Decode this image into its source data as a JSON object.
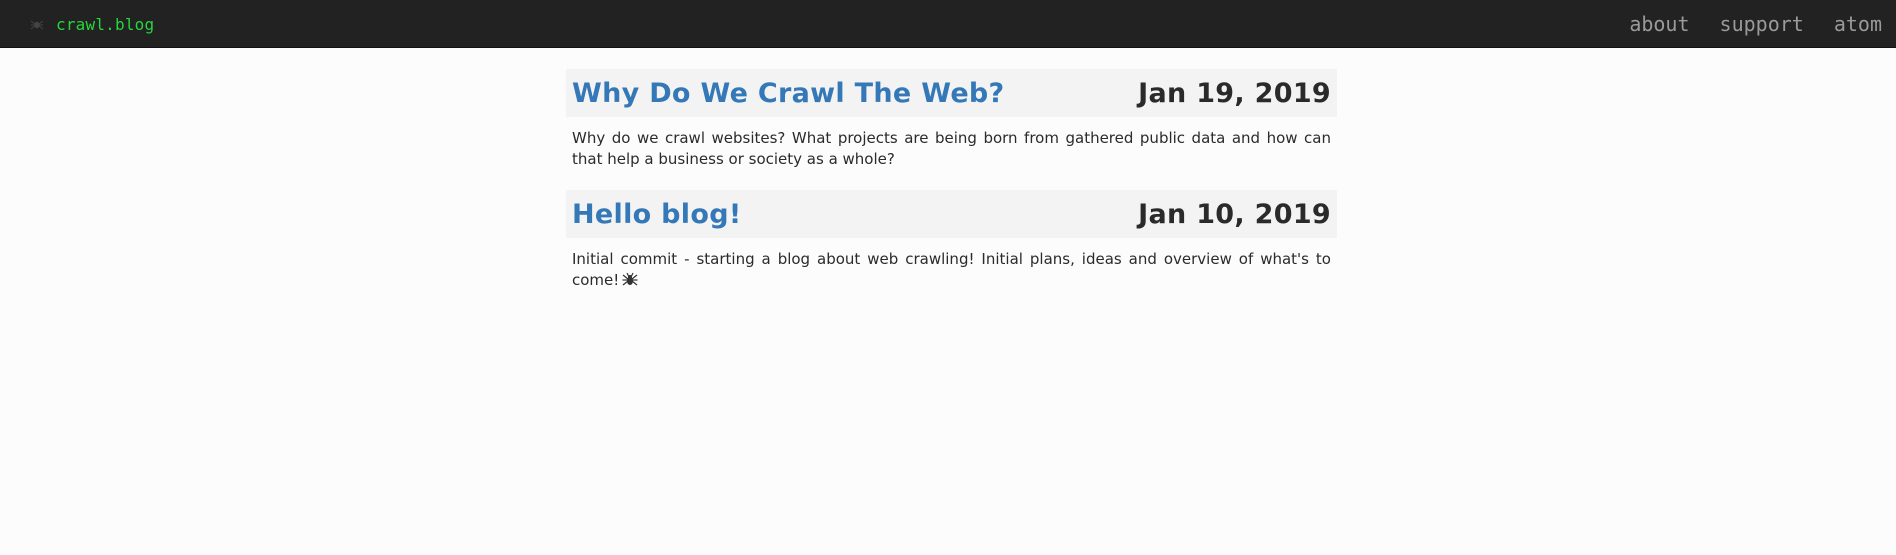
{
  "header": {
    "brand_icon": "spider-icon",
    "brand_text": "crawl.blog",
    "brand_color": "#25d63a",
    "nav": [
      {
        "label": "about"
      },
      {
        "label": "support"
      },
      {
        "label": "atom"
      }
    ]
  },
  "posts": [
    {
      "title": "Why Do We Crawl The Web?",
      "date": "Jan 19, 2019",
      "summary": "Why do we crawl websites? What projects are being born from gathered public data and how can that help a business or society as a whole?"
    },
    {
      "title": "Hello blog!",
      "date": "Jan 10, 2019",
      "summary": "Initial commit - starting a blog about web crawling! Initial plans, ideas and overview of what's to come!",
      "summary_icon": "spider-icon"
    }
  ],
  "colors": {
    "topbar_bg": "#222222",
    "title_link": "#3478b8",
    "post_header_bg": "#f3f3f3",
    "page_bg": "#fcfcfc"
  }
}
